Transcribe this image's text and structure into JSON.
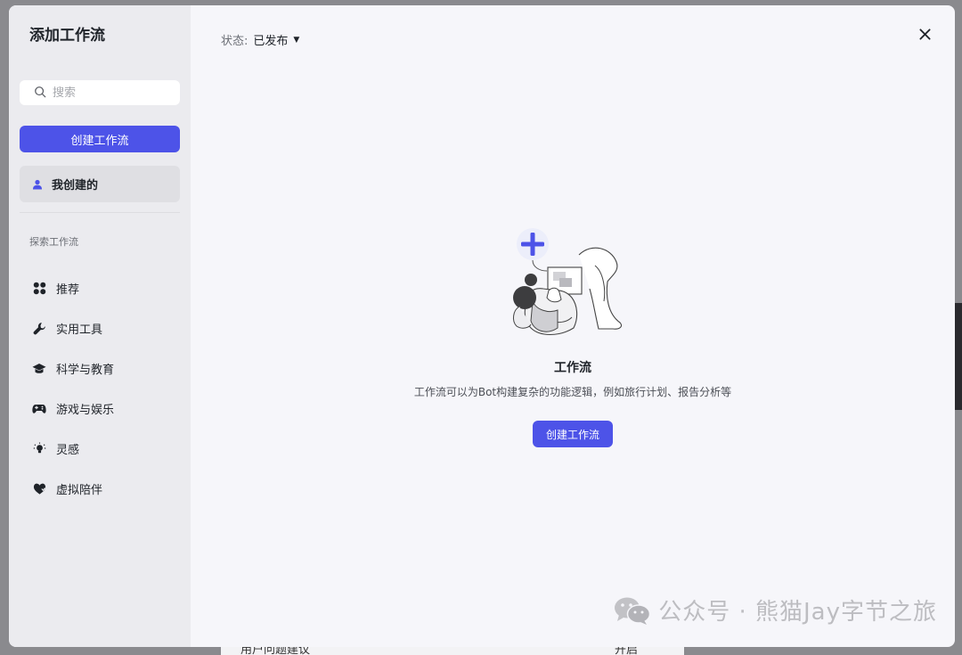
{
  "background": {
    "row_text": "用户问题建议",
    "row_value": "开启"
  },
  "sidebar": {
    "title": "添加工作流",
    "search_placeholder": "搜索",
    "create_label": "创建工作流",
    "mine_label": "我创建的",
    "section_label": "探索工作流",
    "items": [
      {
        "label": "推荐",
        "icon": "grid-icon"
      },
      {
        "label": "实用工具",
        "icon": "wrench-icon"
      },
      {
        "label": "科学与教育",
        "icon": "graduation-cap-icon"
      },
      {
        "label": "游戏与娱乐",
        "icon": "gamepad-icon"
      },
      {
        "label": "灵感",
        "icon": "lightbulb-icon"
      },
      {
        "label": "虚拟陪伴",
        "icon": "heart-icon"
      }
    ]
  },
  "main": {
    "status_label": "状态:",
    "status_value": "已发布",
    "empty_title": "工作流",
    "empty_desc": "工作流可以为Bot构建复杂的功能逻辑，例如旅行计划、报告分析等",
    "create_label": "创建工作流"
  },
  "watermark": "公众号 · 熊猫Jay字节之旅",
  "colors": {
    "accent": "#4d53e8",
    "sidebar_bg": "#ebebef",
    "main_bg": "#f6f6fa",
    "selected_bg": "#dfdfe3"
  }
}
